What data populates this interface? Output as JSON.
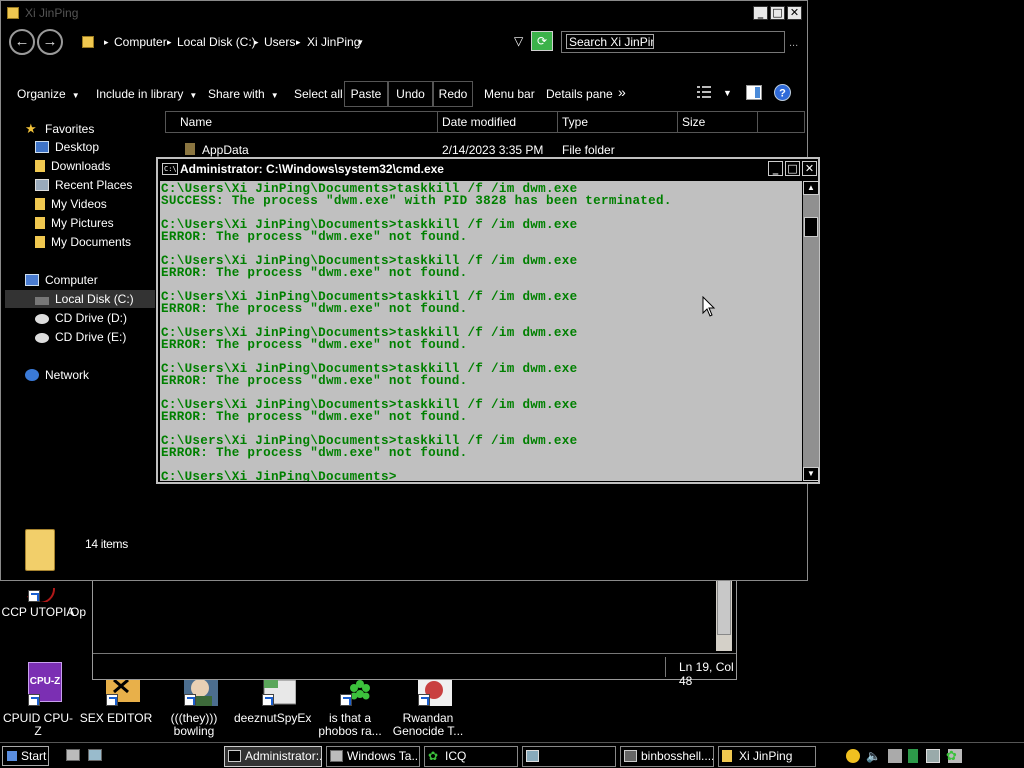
{
  "desktop": {
    "icons": [
      {
        "label": "CCP UTOPIA"
      },
      {
        "label": "Op"
      },
      {
        "label": "CPUID CPU-Z"
      },
      {
        "label": "SEX EDITOR"
      },
      {
        "label": "(((they)))\nbowling"
      },
      {
        "label": "deeznutSpyEx"
      },
      {
        "label": "is that a\nphobos ra..."
      },
      {
        "label": "Rwandan\nGenocide T..."
      }
    ],
    "cpuz_badge": "CPU-Z"
  },
  "notepad": {
    "status": "Ln 19, Col 48"
  },
  "explorer": {
    "title": "Xi JinPing",
    "title_buttons": {
      "minimize": "_",
      "maximize": "□",
      "close": "✕"
    },
    "nav": {
      "back": "←",
      "forward": "→"
    },
    "breadcrumb": [
      "Computer",
      "Local Disk (C:)",
      "Users",
      "Xi JinPing"
    ],
    "search_placeholder": "Search Xi JinPing",
    "search_more": "...",
    "toolbar": {
      "organize": "Organize",
      "include_in_library": "Include in library",
      "share_with": "Share with",
      "select_all": "Select all",
      "paste": "Paste",
      "undo": "Undo",
      "redo": "Redo",
      "menu_bar": "Menu bar",
      "details_pane": "Details pane",
      "more": "»"
    },
    "sidebar": {
      "favorites": "Favorites",
      "favorites_items": [
        "Desktop",
        "Downloads",
        "Recent Places",
        "My Videos",
        "My Pictures",
        "My Documents"
      ],
      "computer": "Computer",
      "computer_items": [
        "Local Disk (C:)",
        "CD Drive (D:)",
        "CD Drive (E:)"
      ],
      "network": "Network"
    },
    "columns": [
      "Name",
      "Date modified",
      "Type",
      "Size"
    ],
    "files": [
      {
        "name": "AppData",
        "date": "2/14/2023 3:35 PM",
        "type": "File folder",
        "size": ""
      }
    ],
    "item_count": "14 items"
  },
  "cmd": {
    "title": "Administrator: C:\\Windows\\system32\\cmd.exe",
    "icon_text": "C:\\",
    "lines": [
      "C:\\Users\\Xi JinPing\\Documents>taskkill /f /im dwm.exe",
      "SUCCESS: The process \"dwm.exe\" with PID 3828 has been terminated.",
      "",
      "C:\\Users\\Xi JinPing\\Documents>taskkill /f /im dwm.exe",
      "ERROR: The process \"dwm.exe\" not found.",
      "",
      "C:\\Users\\Xi JinPing\\Documents>taskkill /f /im dwm.exe",
      "ERROR: The process \"dwm.exe\" not found.",
      "",
      "C:\\Users\\Xi JinPing\\Documents>taskkill /f /im dwm.exe",
      "ERROR: The process \"dwm.exe\" not found.",
      "",
      "C:\\Users\\Xi JinPing\\Documents>taskkill /f /im dwm.exe",
      "ERROR: The process \"dwm.exe\" not found.",
      "",
      "C:\\Users\\Xi JinPing\\Documents>taskkill /f /im dwm.exe",
      "ERROR: The process \"dwm.exe\" not found.",
      "",
      "C:\\Users\\Xi JinPing\\Documents>taskkill /f /im dwm.exe",
      "ERROR: The process \"dwm.exe\" not found.",
      "",
      "C:\\Users\\Xi JinPing\\Documents>taskkill /f /im dwm.exe",
      "ERROR: The process \"dwm.exe\" not found.",
      "",
      "C:\\Users\\Xi JinPing\\Documents>"
    ],
    "text_color": "#008000",
    "background_color": "#c0c0c0"
  },
  "taskbar": {
    "start": "Start",
    "tasks": [
      {
        "label": "Administrator:...",
        "active": true
      },
      {
        "label": "Windows Ta...",
        "active": false
      },
      {
        "label": "ICQ",
        "active": false
      },
      {
        "label": "",
        "active": false
      },
      {
        "label": "binbosshell....",
        "active": false
      },
      {
        "label": "Xi JinPing",
        "active": false
      }
    ]
  }
}
